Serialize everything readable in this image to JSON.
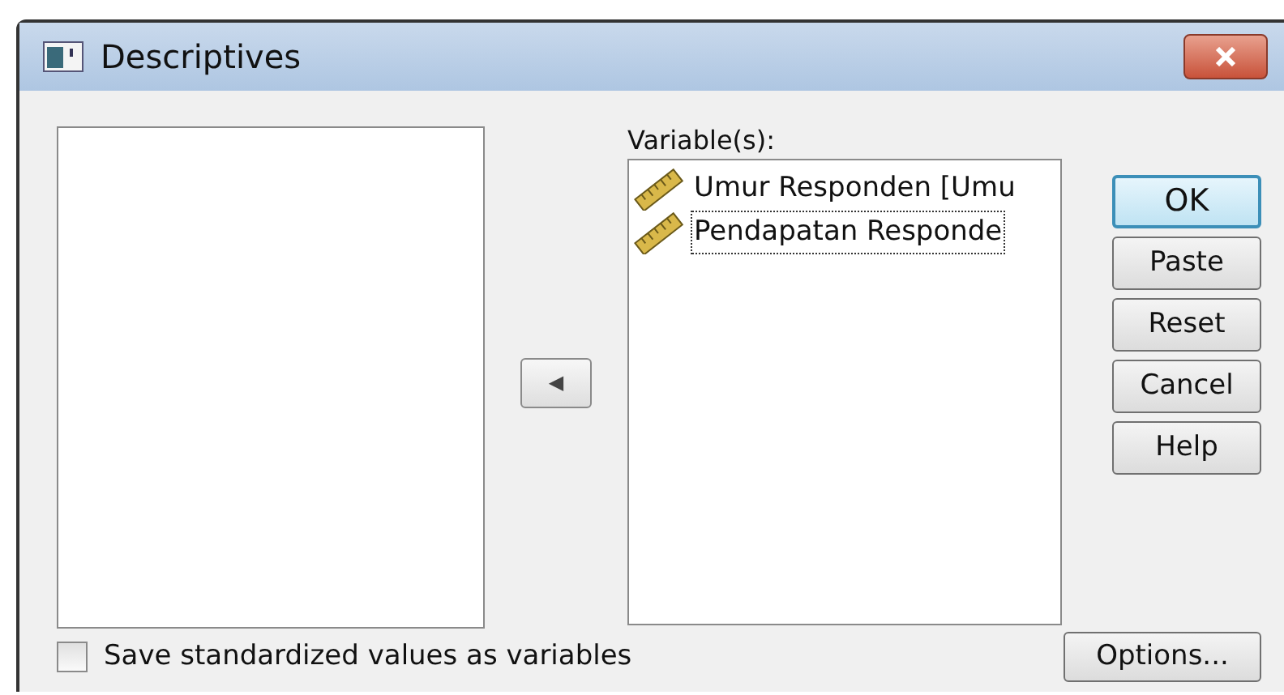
{
  "window": {
    "title": "Descriptives"
  },
  "move_button": {
    "symbol": "◀"
  },
  "variables": {
    "label": "Variable(s):",
    "items": [
      {
        "label": "Umur Responden [Umu",
        "selected": false
      },
      {
        "label": "Pendapatan Responde",
        "selected": true
      }
    ]
  },
  "buttons": [
    {
      "label": "OK",
      "default": true
    },
    {
      "label": "Paste",
      "default": false
    },
    {
      "label": "Reset",
      "default": false
    },
    {
      "label": "Cancel",
      "default": false
    },
    {
      "label": "Help",
      "default": false
    }
  ],
  "save_checkbox": {
    "label": "Save standardized values as variables",
    "checked": false
  },
  "options_button": {
    "label": "Options..."
  }
}
